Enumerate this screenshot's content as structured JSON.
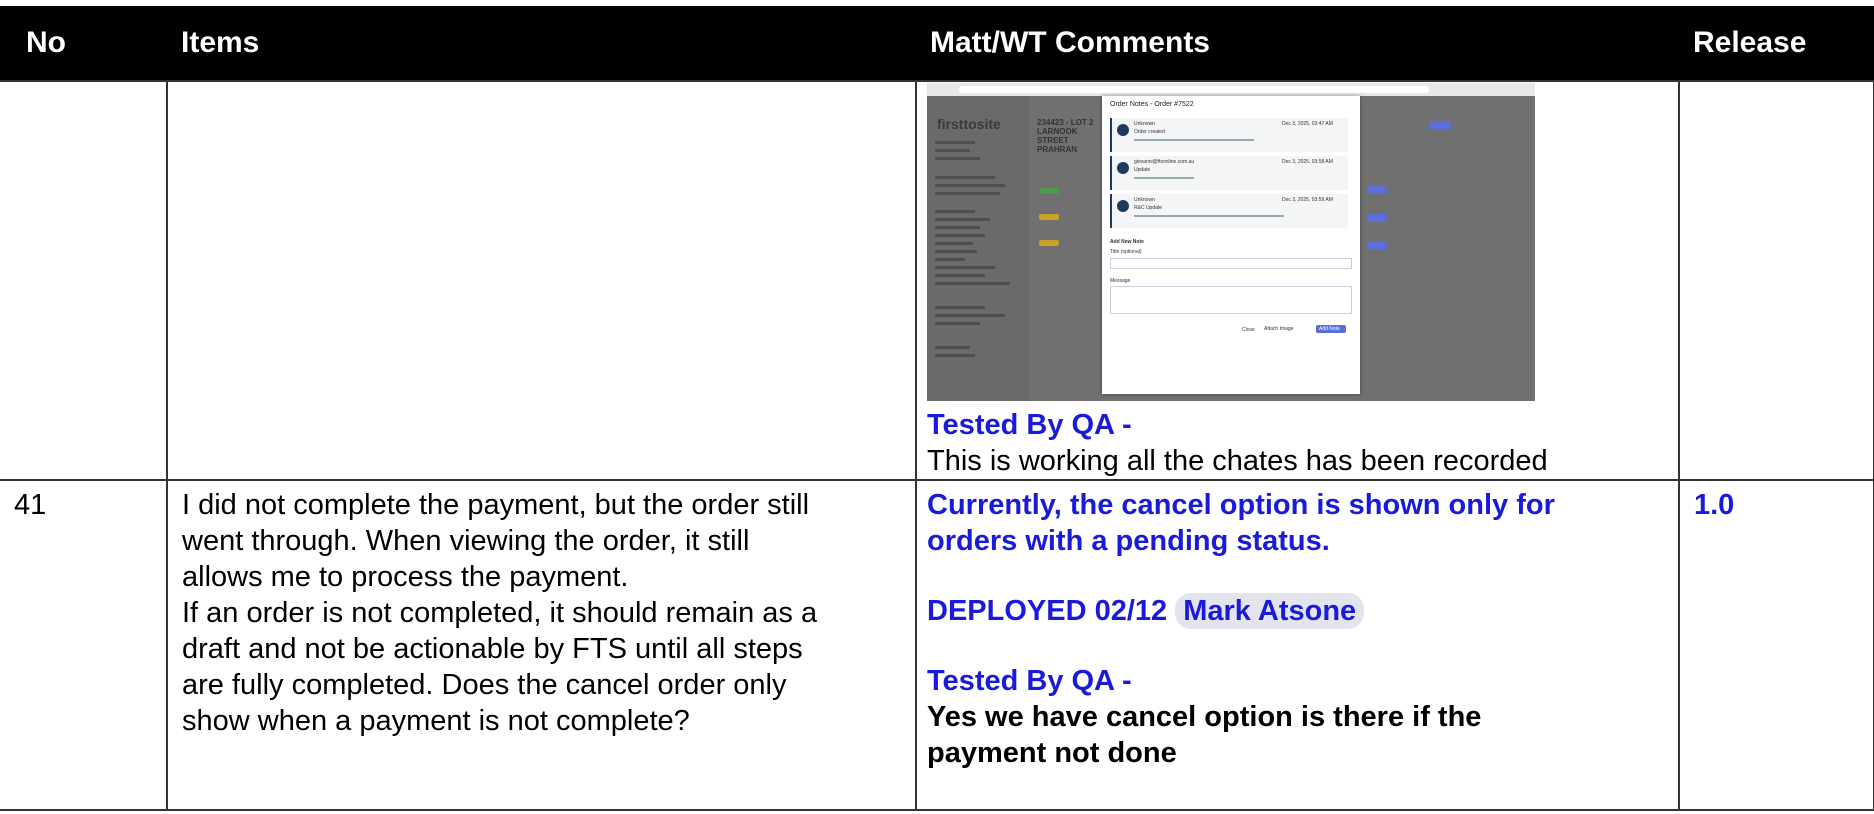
{
  "header": {
    "no": "No",
    "items": "Items",
    "comments": "Matt/WT Comments",
    "release": "Release"
  },
  "row_prev": {
    "no": "",
    "items": "",
    "screenshot": {
      "modal_title": "Order Notes - Order #7522",
      "brand": "firsttosite",
      "project_title": "234423 - LOT 2 LARNOOK STREET PRAHRAN",
      "notes": [
        {
          "author": "Unknown",
          "title": "Order created",
          "date": "Dec 3, 2025, 03:47 AM"
        },
        {
          "author": "giovanni@ftsonline.com.au",
          "title": "Update",
          "date": "Dec 3, 2025, 03:58 AM"
        },
        {
          "author": "Unknown",
          "title": "R&C Update",
          "date": "Dec 3, 2025, 03:59 AM"
        }
      ],
      "add_note": "Add New Note",
      "title_label": "Title (optional)",
      "message_label": "Message",
      "close_button": "Close",
      "attach_button": "Attach Image",
      "add_button": "Add Note"
    },
    "qa_label": "Tested By QA -",
    "qa_text": "This is working all the chates has been recorded",
    "release": ""
  },
  "row_41": {
    "no": "41",
    "items": [
      "I did not complete the payment, but the order still",
      "went through. When viewing the order, it still",
      "allows me to process the payment.",
      "If an order is not completed, it should remain as a",
      "draft and not be actionable by FTS until all steps",
      "are fully completed. Does the cancel order only",
      "show when a payment is not complete?"
    ],
    "comment_1": "Currently, the cancel option is shown only for",
    "comment_2": "orders with a pending status.",
    "deployed": "DEPLOYED 02/12",
    "mention": "Mark Atsone",
    "qa_label": "Tested By QA -",
    "qa_text_1": "Yes we have cancel option is there if the",
    "qa_text_2": "payment not done",
    "release": "1.0"
  }
}
